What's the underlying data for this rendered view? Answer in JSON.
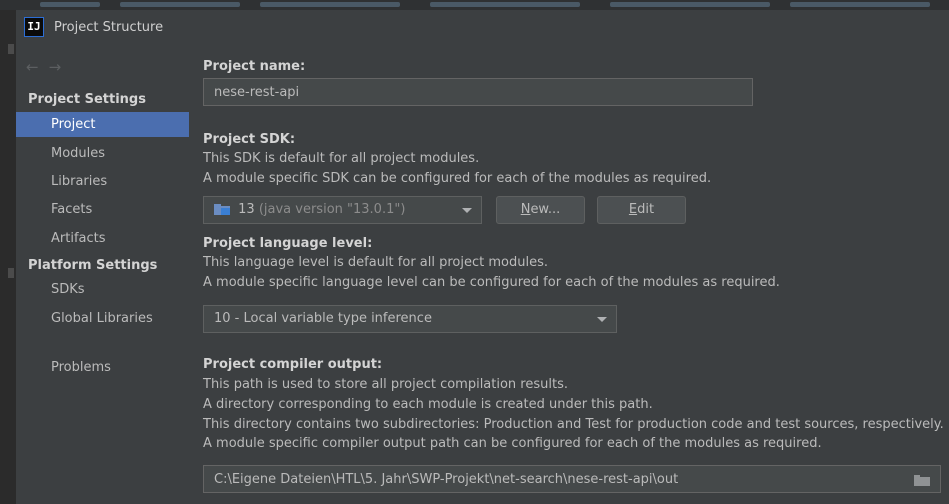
{
  "window": {
    "title": "Project Structure",
    "app_icon_text": "IJ"
  },
  "sidebar": {
    "back_arrow": "←",
    "forward_arrow": "→",
    "project_settings_header": "Project Settings",
    "project_items": [
      "Project",
      "Modules",
      "Libraries",
      "Facets",
      "Artifacts"
    ],
    "platform_settings_header": "Platform Settings",
    "platform_items": [
      "SDKs",
      "Global Libraries"
    ],
    "problems": "Problems",
    "selected": "Project"
  },
  "project": {
    "name_label": "Project name:",
    "name_value": "nese-rest-api",
    "sdk_label": "Project SDK:",
    "sdk_desc1": "This SDK is default for all project modules.",
    "sdk_desc2": "A module specific SDK can be configured for each of the modules as required.",
    "sdk_selected_version": "13",
    "sdk_selected_detail": "(java version \"13.0.1\")",
    "new_button_mnemonic": "N",
    "new_button_rest": "ew...",
    "edit_button_mnemonic": "E",
    "edit_button_rest": "dit",
    "language_label": "Project language level:",
    "language_desc1": "This language level is default for all project modules.",
    "language_desc2": "A module specific language level can be configured for each of the modules as required.",
    "language_value": "10 - Local variable type inference",
    "output_label": "Project compiler output:",
    "output_desc1": "This path is used to store all project compilation results.",
    "output_desc2": "A directory corresponding to each module is created under this path.",
    "output_desc3": "This directory contains two subdirectories: Production and Test for production code and test sources, respectively.",
    "output_desc4": "A module specific compiler output path can be configured for each of the modules as required.",
    "output_path": "C:\\Eigene Dateien\\HTL\\5. Jahr\\SWP-Projekt\\net-search\\nese-rest-api\\out"
  },
  "colors": {
    "background": "#3c3f41",
    "selection": "#4b6eaf",
    "input_background": "#45494a",
    "text": "#bbbbbb"
  }
}
